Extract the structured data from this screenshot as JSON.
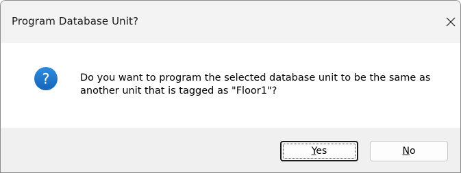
{
  "dialog": {
    "title": "Program Database Unit?",
    "close_icon": "close-icon",
    "icon": "question-icon",
    "icon_color": "#1a73c8",
    "message": "Do you want to program the selected database unit to be the same as another unit that is tagged as \"Floor1\"?",
    "buttons": {
      "yes": {
        "mnemonic": "Y",
        "rest": "es"
      },
      "no": {
        "mnemonic": "N",
        "rest": "o"
      }
    }
  }
}
